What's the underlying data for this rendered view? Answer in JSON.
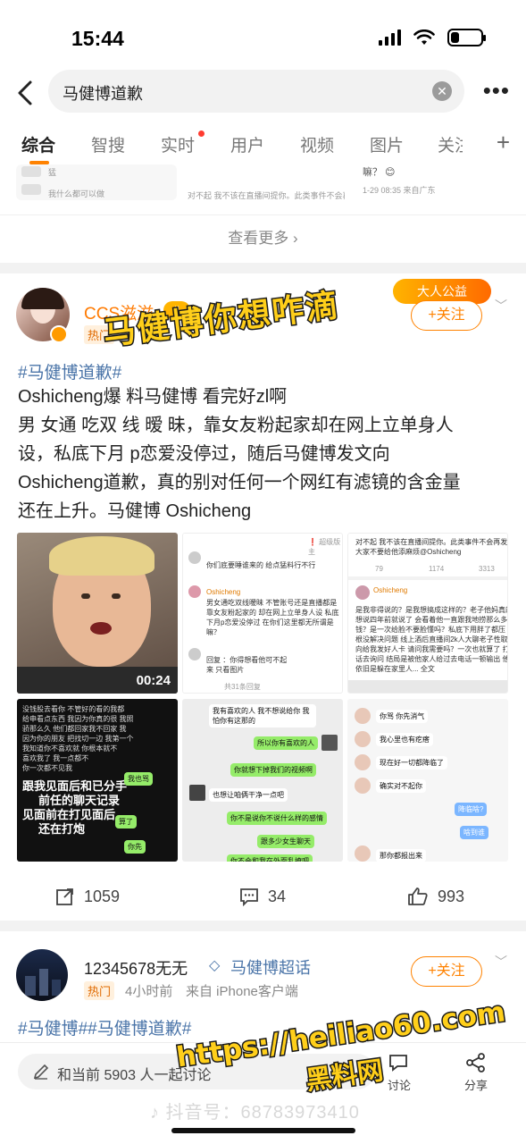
{
  "status_bar": {
    "time": "15:44"
  },
  "search": {
    "query": "马健博道歉",
    "clear_icon": "x-icon"
  },
  "tabs": [
    {
      "label": "综合",
      "active": true
    },
    {
      "label": "智搜",
      "active": false
    },
    {
      "label": "实时",
      "active": false
    },
    {
      "label": "用户",
      "active": false
    },
    {
      "label": "视频",
      "active": false
    },
    {
      "label": "图片",
      "active": false
    },
    {
      "label": "关注",
      "active": false
    }
  ],
  "top_strip": {
    "left_lines": [
      "猛",
      "我什么都可以做"
    ],
    "mid_line": "对不起 我不该在直播间提你。此类事件不会再发生",
    "mid_time": "1-29 08:35 来自广东",
    "right_line": "嘛？ 😊"
  },
  "view_more": "查看更多",
  "post1": {
    "username": "CCS滋滋",
    "level_badge": "II",
    "hot_label": "热门",
    "follow_label": "+关注",
    "banner_text": "马健博你想咋滴",
    "top_badge": "大人公益",
    "hashtag": "#马健博道歉#",
    "body_lines": [
      "Oshicheng爆 料马健博 看完好zl啊",
      "男 女通 吃双 线 暧 昧，靠女友粉起家却在网上立单身人",
      "设，私底下月 p恋爱没停过，随后马健博发文向",
      "Oshicheng道歉，真的别对任何一个网红有滤镜的含金量",
      "还在上升。马健博 Oshicheng"
    ],
    "video_duration": "00:24",
    "img2": {
      "header": "❗ 超级版主",
      "q1": "你们底要睡谁来的 给点猛料行不行",
      "name": "Oshicheng",
      "lines": [
        "男女通吃双线暧昧 不管账号还是直播都是",
        "靠女友粉起家的 却在网上立单身人设 私底",
        "下月p恋爱没停过 在你们这里都无所谓是",
        "嘛？"
      ],
      "reply": "回复 ：你得想看他可不起",
      "reply2": "来 只看图片",
      "footer": "共31条回复"
    },
    "img3": {
      "top": "对不起 我不该在直播间提你。此类事件不会再发生",
      "top2": "大家不要给他添麻烦@Oshicheng",
      "stats": [
        "79",
        "1174",
        "3313"
      ],
      "name": "Oshicheng",
      "lines": [
        "是我非得说的？是我想搞成这样的？老子他妈真的",
        "想说四年前就说了 会看着他一直跟我地捞那么多",
        "钱？是一次给脸不要脸懂吗？私底下用胖了都压",
        "根没解决问题 线上酒后直播间2k人大聊老子性取",
        "向给我发好人卡 请问我需要吗？一次也就算了 打电",
        "话去询问 结局是被他家人给过去电话一顿输出 他",
        "依旧是躲在家里人... 全文"
      ]
    },
    "img4": {
      "lines": [
        "没钱股去看你 不管好的看的我都",
        "给申看点东西 我因为你真的很 我照",
        "骄那么久 他们都回家我不回家 我",
        "因为你的朋友 把找切一边 我第一个",
        "我知道你不喜欢就 你根本就不",
        "喜欢我了 我一点都不",
        "你一次都不见我"
      ],
      "caption": [
        "跟我见面后和已分手",
        "前任的聊天记录",
        "见面前在打见面后",
        "还在打炮"
      ],
      "bubbles": [
        "我也骂",
        "算了",
        "你先"
      ]
    },
    "img5": {
      "bubbles": [
        "我有喜欢的人 我不想说给你 我怕你有这那的",
        "所以你有喜欢的人",
        "你就想下掉我们的视频啊",
        "也想让咱俩干净一点吧",
        "你不是说你不说什么样的感情",
        "跟多少女生聊天",
        "你不会和我在外面乱撩吧"
      ]
    },
    "img6": {
      "bubbles": [
        "你骂 你先消气",
        "我心里也有疙瘩",
        "现在好一切都降临了",
        "确实对不起你",
        "降临啥?",
        "啥到谁",
        "那你都报出来"
      ]
    },
    "actions": {
      "repost": "1059",
      "comment": "34",
      "like": "993"
    }
  },
  "post2": {
    "username": "12345678无无",
    "supertopic": "马健博超话",
    "hot_label": "热门",
    "time": "4小时前",
    "source": "来自 iPhone客户端",
    "follow_label": "+关注",
    "hashtags": "#马健博##马健博道歉#"
  },
  "bottom_bar": {
    "comment_placeholder": "和当前 5903 人一起讨论",
    "comment_label": "讨论",
    "share_label": "分享"
  },
  "overlays": {
    "url": "https://heiliao60.com",
    "site_name": "黑料网",
    "watermark": "♪ 抖音号：68783973410"
  },
  "colors": {
    "accent": "#ff8200",
    "link": "#4a74a8",
    "overlay_yellow": "#ffcf1a"
  }
}
